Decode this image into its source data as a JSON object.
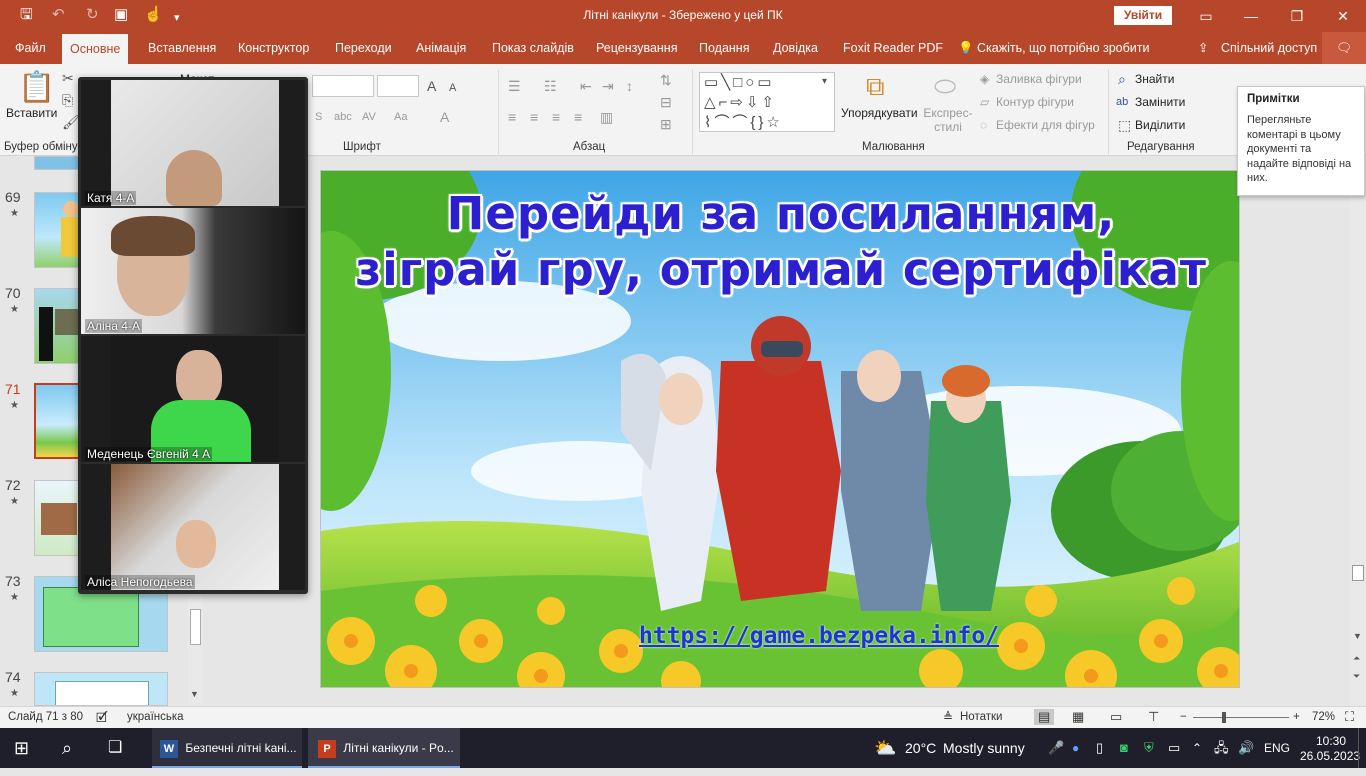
{
  "window": {
    "title": "Літні канікули  -  Збережено у цей ПК",
    "signin": "Увійти",
    "controls": {
      "minimize": "—",
      "restore": "❐",
      "close": "✕"
    }
  },
  "ribbon_tabs": [
    "Файл",
    "Основне",
    "Вставлення",
    "Конструктор",
    "Переходи",
    "Анімація",
    "Показ слайдів",
    "Рецензування",
    "Подання",
    "Довідка",
    "Foxit Reader PDF"
  ],
  "tell_me": "Скажіть, що потрібно зробити",
  "share": "Спільний доступ",
  "ribbon": {
    "paste": "Вставити",
    "clipboard_group": "Буфер обміну",
    "font_group": "Шрифт",
    "paragraph_group": "Абзац",
    "drawing_group": "Малювання",
    "editing_group": "Редагування",
    "arrange": "Упорядкувати",
    "quick_styles": "Експрес-стилі",
    "shape_fill": "Заливка фігури",
    "shape_outline": "Контур фігури",
    "shape_effects": "Ефекти для фігур",
    "find": "Знайти",
    "replace": "Замінити",
    "select": "Виділити",
    "layout_partial": "Макет"
  },
  "notes_tooltip": {
    "title": "Примітки",
    "body": "Перегляньте коментарі в цьому документі та надайте відповіді на них."
  },
  "thumbnails": [
    {
      "num": "69",
      "star": "★",
      "selected": false
    },
    {
      "num": "70",
      "star": "★",
      "selected": false
    },
    {
      "num": "71",
      "star": "★",
      "selected": true
    },
    {
      "num": "72",
      "star": "★",
      "selected": false
    },
    {
      "num": "73",
      "star": "★",
      "selected": false
    },
    {
      "num": "74",
      "star": "★",
      "selected": false
    }
  ],
  "slide": {
    "title_line1": "Перейди за посиланням,",
    "title_line2": "зіграй гру, отримай сертифікат",
    "link": "https://game.bezpeka.info/"
  },
  "video_participants": [
    {
      "name": "Катя  4-А"
    },
    {
      "name": "Аліна 4-А"
    },
    {
      "name": "Меденець Євгеній 4 А"
    },
    {
      "name": "Аліса Непогодьева"
    }
  ],
  "status": {
    "slide_info": "Слайд 71 з 80",
    "language": "українська",
    "notes": "Нотатки",
    "zoom": "72%"
  },
  "taskbar": {
    "word_item": "Безпечні літні kані...",
    "ppt_item": "Літні канікули - Po...",
    "weather_temp": "20°C",
    "weather_desc": "Mostly sunny",
    "lang": "ENG",
    "time": "10:30",
    "date": "26.05.2023"
  },
  "colors": {
    "accent": "#b7472a",
    "title_text": "#2b1fd0",
    "link_text": "#1a35d9",
    "selected_thumb": "#c43e1c"
  }
}
